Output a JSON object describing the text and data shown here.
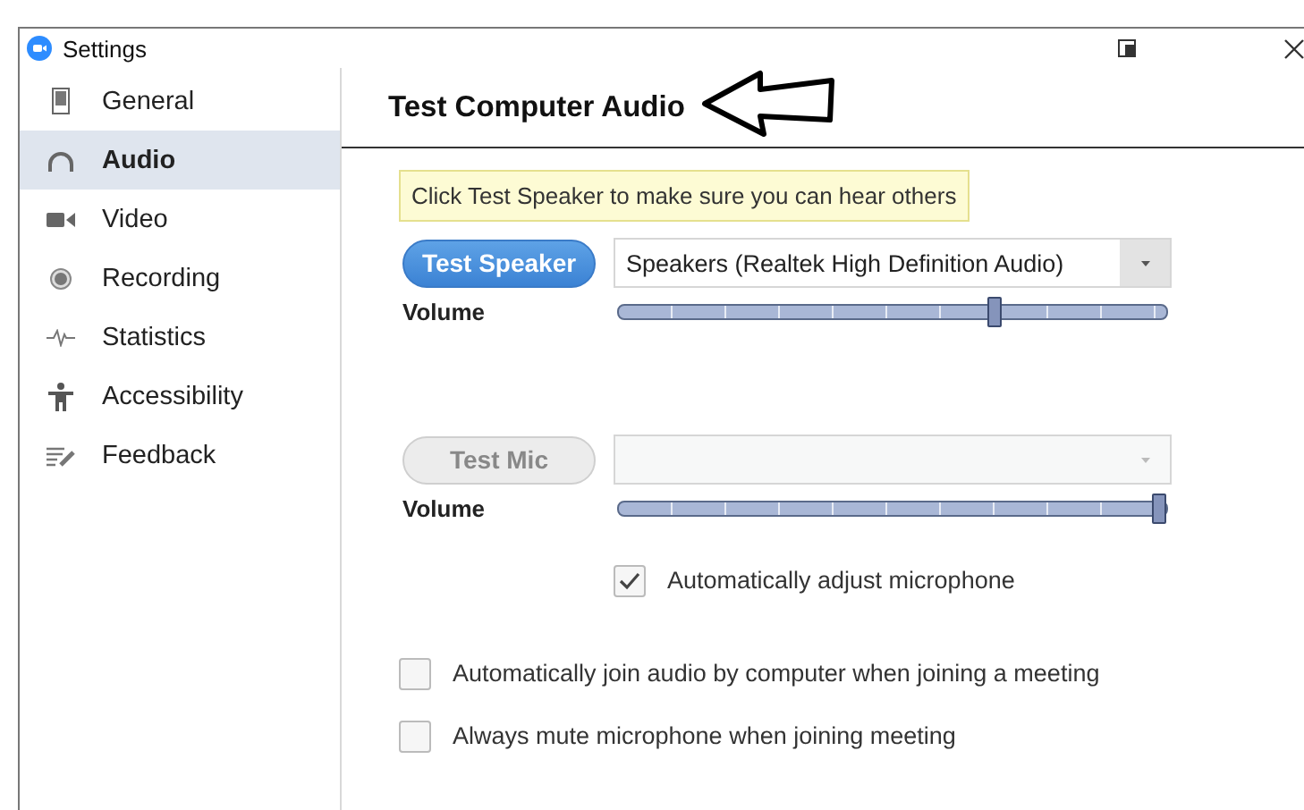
{
  "window": {
    "title": "Settings"
  },
  "sidebar": {
    "items": [
      {
        "label": "General",
        "selected": false
      },
      {
        "label": "Audio",
        "selected": true
      },
      {
        "label": "Video",
        "selected": false
      },
      {
        "label": "Recording",
        "selected": false
      },
      {
        "label": "Statistics",
        "selected": false
      },
      {
        "label": "Accessibility",
        "selected": false
      },
      {
        "label": "Feedback",
        "selected": false
      }
    ]
  },
  "section_title": "Test Computer Audio",
  "tooltip": "Click Test Speaker to make sure you can hear others",
  "devices": [
    {
      "button": "Test Speaker",
      "disabled": false,
      "device": "Speakers (Realtek High Definition Audio)",
      "volume_label": "Volume",
      "level": 0.69
    },
    {
      "button": "Test Mic",
      "disabled": true,
      "volume_label": "Volume",
      "level": 1.0
    }
  ],
  "auto_adjust": {
    "label": "Automatically adjust microphone",
    "checked": true
  },
  "options": [
    {
      "label": "Automatically join audio by computer when joining a meeting",
      "checked": false
    },
    {
      "label": "Always mute microphone when joining meeting",
      "checked": false
    }
  ]
}
